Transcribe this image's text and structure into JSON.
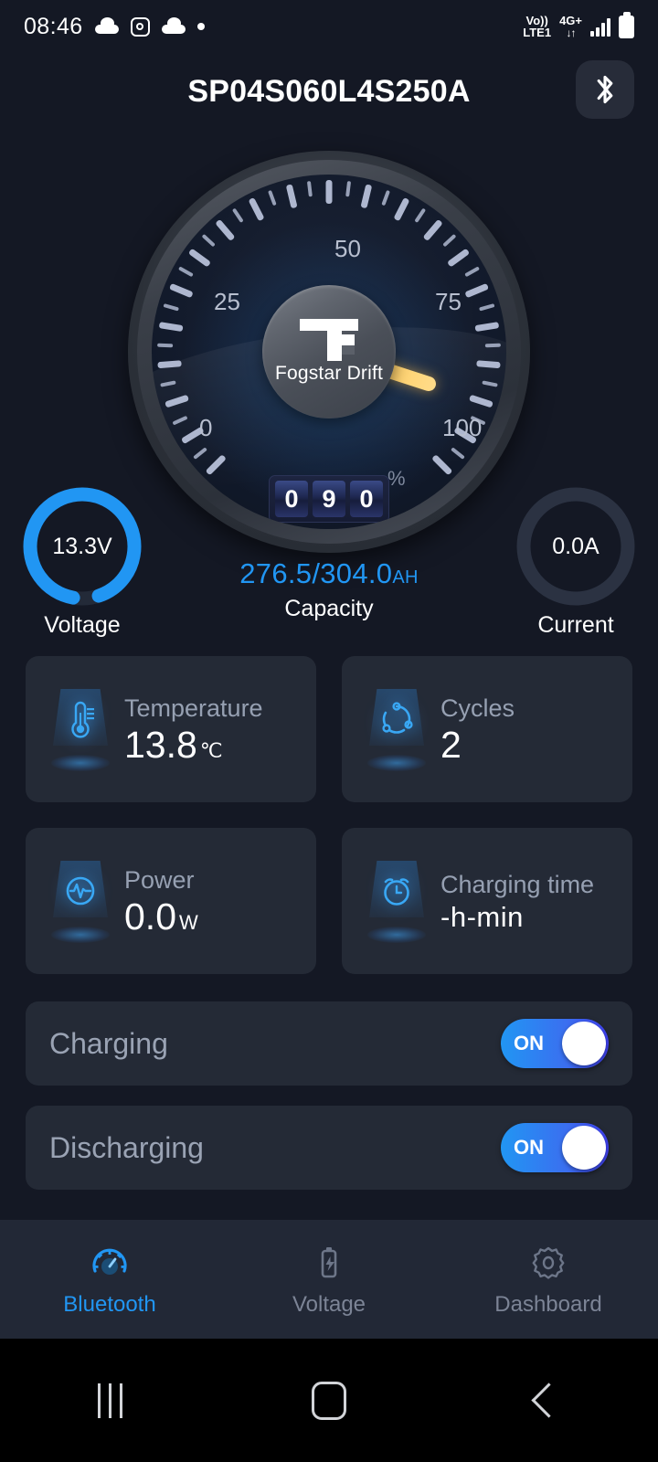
{
  "status_bar": {
    "clock": "08:46",
    "icons_left": [
      "cloud-icon",
      "instagram-icon",
      "cloud-icon",
      "dot-icon"
    ],
    "volte_line1": "Vo))",
    "volte_line2": "LTE1",
    "network_line1": "4G+",
    "network_line2": "↓↑",
    "signal_icon": "signal-bars-icon",
    "battery_icon": "battery-icon"
  },
  "header": {
    "title": "SP04S060L4S250A",
    "bluetooth_icon": "bluetooth-icon"
  },
  "gauge": {
    "brand": "Fogstar Drift",
    "scale_labels": [
      "0",
      "25",
      "50",
      "75",
      "100"
    ],
    "odometer_digits": [
      "0",
      "9",
      "0"
    ],
    "unit": "%",
    "value": 90,
    "needle_color": "#ffd06a"
  },
  "rings": {
    "voltage": {
      "label": "Voltage",
      "value": "13.3V",
      "percent": 92,
      "color": "#2196f3"
    },
    "current": {
      "label": "Current",
      "value": "0.0A",
      "percent": 0,
      "color": "#2d3545"
    },
    "capacity": {
      "label": "Capacity",
      "value": "276.5/304.0",
      "unit": "AH",
      "color": "#2196f3"
    }
  },
  "cards": [
    {
      "label": "Temperature",
      "value": "13.8",
      "unit": "℃",
      "icon": "thermometer-icon"
    },
    {
      "label": "Cycles",
      "value": "2",
      "unit": "",
      "icon": "cycles-icon"
    },
    {
      "label": "Power",
      "value": "0.0",
      "unit": "W",
      "icon": "power-pulse-icon"
    },
    {
      "label": "Charging time",
      "value": "-h-min",
      "unit": "",
      "icon": "alarm-clock-icon"
    }
  ],
  "toggles": [
    {
      "label": "Charging",
      "state": "ON"
    },
    {
      "label": "Discharging",
      "state": "ON"
    }
  ],
  "bottom_nav": [
    {
      "label": "Bluetooth",
      "icon": "speedometer-icon",
      "active": true
    },
    {
      "label": "Voltage",
      "icon": "battery-bolt-icon",
      "active": false
    },
    {
      "label": "Dashboard",
      "icon": "gear-icon",
      "active": false
    }
  ],
  "android_nav": {
    "recents": "recents-icon",
    "home": "home-icon",
    "back": "back-icon"
  }
}
